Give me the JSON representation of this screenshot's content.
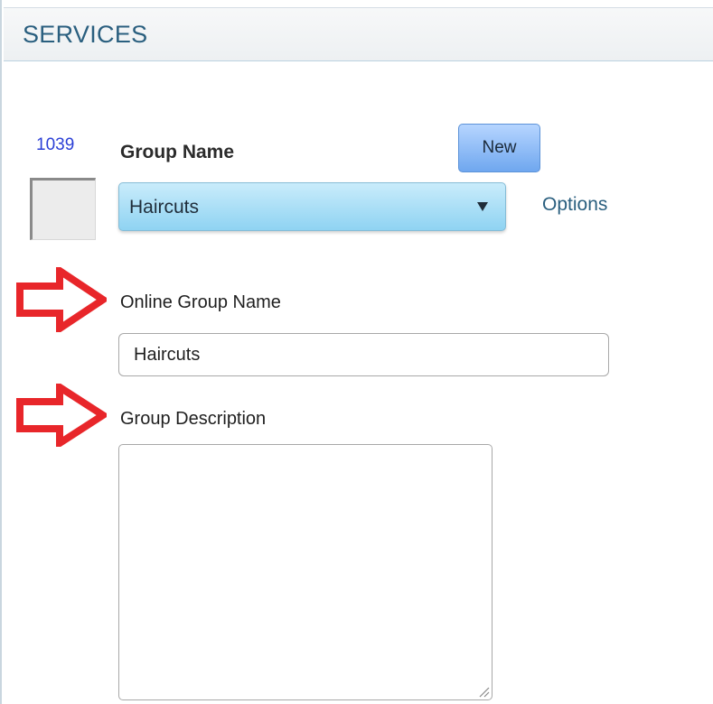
{
  "header": {
    "title": "SERVICES"
  },
  "group": {
    "id_label": "1039",
    "name_label": "Group Name",
    "new_button_label": "New",
    "selected_group": "Haircuts",
    "options_label": "Options"
  },
  "online_group": {
    "label": "Online Group Name",
    "value": "Haircuts"
  },
  "description": {
    "label": "Group Description",
    "value": ""
  },
  "icons": {
    "annotation_arrow": "arrow-right-icon",
    "dropdown": "chevron-down-icon",
    "resize": "resize-grip-icon"
  },
  "colors": {
    "header_text": "#2a5f7f",
    "id_text": "#2b3fd6",
    "arrow": "#e8262a",
    "select_bg": "#8fd3f2",
    "button_bg": "#6fa7ef"
  }
}
